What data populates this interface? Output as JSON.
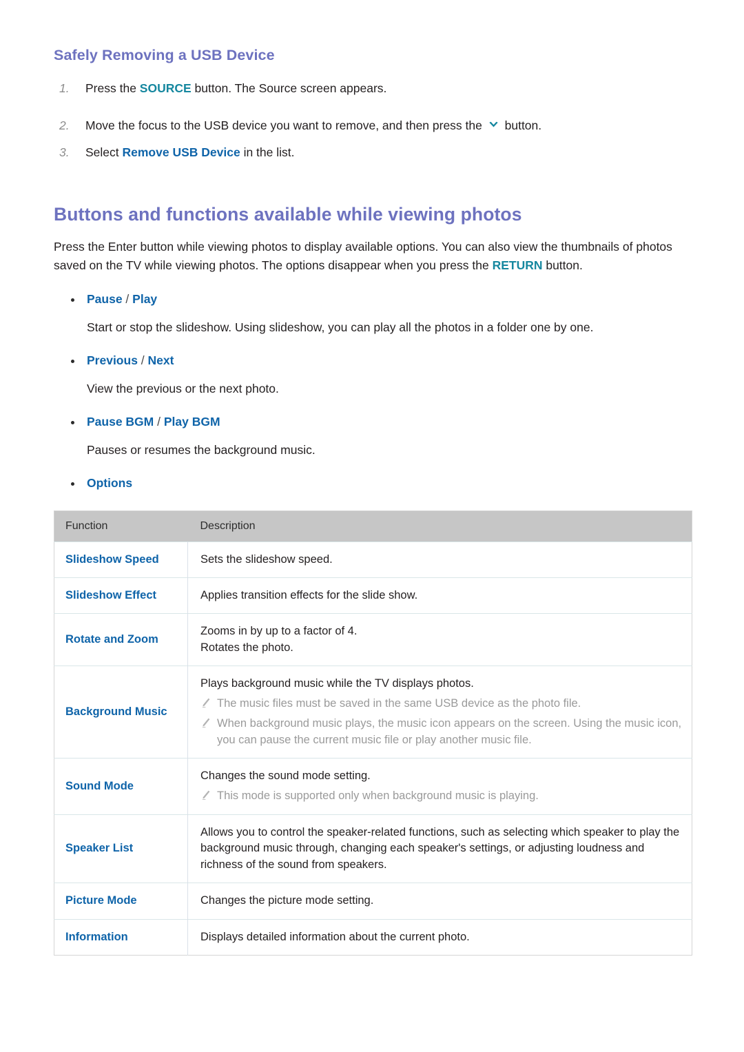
{
  "colors": {
    "heading": "#6d72bf",
    "link_blue": "#0f64a9",
    "teal": "#15879f",
    "note_gray": "#9a9a9a",
    "table_header_bg": "#c6c6c6"
  },
  "subsection": {
    "title": "Safely Removing a USB Device",
    "steps": [
      {
        "num": "1.",
        "parts": [
          {
            "t": "Press the ",
            "s": "plain"
          },
          {
            "t": "SOURCE",
            "s": "teal"
          },
          {
            "t": " button. The Source screen appears.",
            "s": "plain"
          }
        ]
      },
      {
        "num": "2.",
        "parts": [
          {
            "t": "Move the focus to the USB device you want to remove, and then press the ",
            "s": "plain"
          },
          {
            "t": "chevron-down-icon",
            "s": "icon"
          },
          {
            "t": " button.",
            "s": "plain"
          }
        ]
      },
      {
        "num": "3.",
        "parts": [
          {
            "t": "Select ",
            "s": "plain"
          },
          {
            "t": "Remove USB Device",
            "s": "blue"
          },
          {
            "t": " in the list.",
            "s": "plain"
          }
        ]
      }
    ]
  },
  "section": {
    "title": "Buttons and functions available while viewing photos",
    "intro_parts": [
      {
        "t": "Press the Enter button while viewing photos to display available options. You can also view the thumbnails of photos saved on the TV while viewing photos. The options disappear when you press the ",
        "s": "plain"
      },
      {
        "t": "RETURN",
        "s": "teal"
      },
      {
        "t": " button.",
        "s": "plain"
      }
    ],
    "features": [
      {
        "title_parts": [
          {
            "t": "Pause",
            "s": "blue"
          },
          {
            "t": " / ",
            "s": "sep"
          },
          {
            "t": "Play",
            "s": "blue"
          }
        ],
        "desc": "Start or stop the slideshow. Using slideshow, you can play all the photos in a folder one by one."
      },
      {
        "title_parts": [
          {
            "t": "Previous",
            "s": "blue"
          },
          {
            "t": " / ",
            "s": "sep"
          },
          {
            "t": "Next",
            "s": "blue"
          }
        ],
        "desc": "View the previous or the next photo."
      },
      {
        "title_parts": [
          {
            "t": "Pause BGM",
            "s": "blue"
          },
          {
            "t": " / ",
            "s": "sep"
          },
          {
            "t": "Play BGM",
            "s": "blue"
          }
        ],
        "desc": "Pauses or resumes the background music."
      },
      {
        "title_parts": [
          {
            "t": "Options",
            "s": "blue"
          }
        ],
        "desc": ""
      }
    ]
  },
  "options_table": {
    "headers": [
      "Function",
      "Description"
    ],
    "rows": [
      {
        "function": "Slideshow Speed",
        "lines": [
          "Sets the slideshow speed."
        ],
        "notes": []
      },
      {
        "function": "Slideshow Effect",
        "lines": [
          "Applies transition effects for the slide show."
        ],
        "notes": []
      },
      {
        "function": "Rotate and Zoom",
        "lines": [
          "Zooms in by up to a factor of 4.",
          "Rotates the photo."
        ],
        "notes": []
      },
      {
        "function": "Background Music",
        "lines": [
          "Plays background music while the TV displays photos."
        ],
        "notes": [
          "The music files must be saved in the same USB device as the photo file.",
          "When background music plays, the music icon appears on the screen. Using the music icon, you can pause the current music file or play another music file."
        ]
      },
      {
        "function": "Sound Mode",
        "lines": [
          "Changes the sound mode setting."
        ],
        "notes": [
          "This mode is supported only when background music is playing."
        ]
      },
      {
        "function": "Speaker List",
        "lines": [
          "Allows you to control the speaker-related functions, such as selecting which speaker to play the background music through, changing each speaker's settings, or adjusting loudness and richness of the sound from speakers."
        ],
        "notes": []
      },
      {
        "function": "Picture Mode",
        "lines": [
          "Changes the picture mode setting."
        ],
        "notes": []
      },
      {
        "function": "Information",
        "lines": [
          "Displays detailed information about the current photo."
        ],
        "notes": []
      }
    ]
  }
}
